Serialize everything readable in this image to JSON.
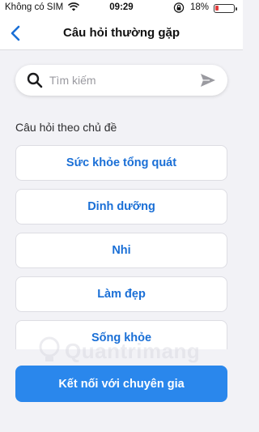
{
  "status_bar": {
    "carrier": "Không có SIM",
    "time": "09:29",
    "battery_text": "18%",
    "battery_level": 0.18,
    "battery_color": "#e23d3d",
    "icons": [
      "wifi-icon",
      "lock-rotation-icon",
      "battery-icon",
      "charging-icon"
    ]
  },
  "nav": {
    "title": "Câu hỏi thường gặp",
    "back_icon": "chevron-left-icon"
  },
  "search": {
    "placeholder": "Tìm kiếm",
    "value": "",
    "icons": [
      "search-icon",
      "send-icon"
    ]
  },
  "section_title": "Câu hỏi theo chủ đề",
  "topics": [
    {
      "label": "Sức khỏe tổng quát"
    },
    {
      "label": "Dinh dưỡng"
    },
    {
      "label": "Nhi"
    },
    {
      "label": "Làm đẹp"
    },
    {
      "label": "Sống khỏe"
    }
  ],
  "watermark": "Quantrimang",
  "cta": {
    "label": "Kết nối với chuyên gia"
  },
  "colors": {
    "accent": "#2a87ec",
    "topic_text": "#1a6fd6",
    "background": "#f2f2f6"
  }
}
